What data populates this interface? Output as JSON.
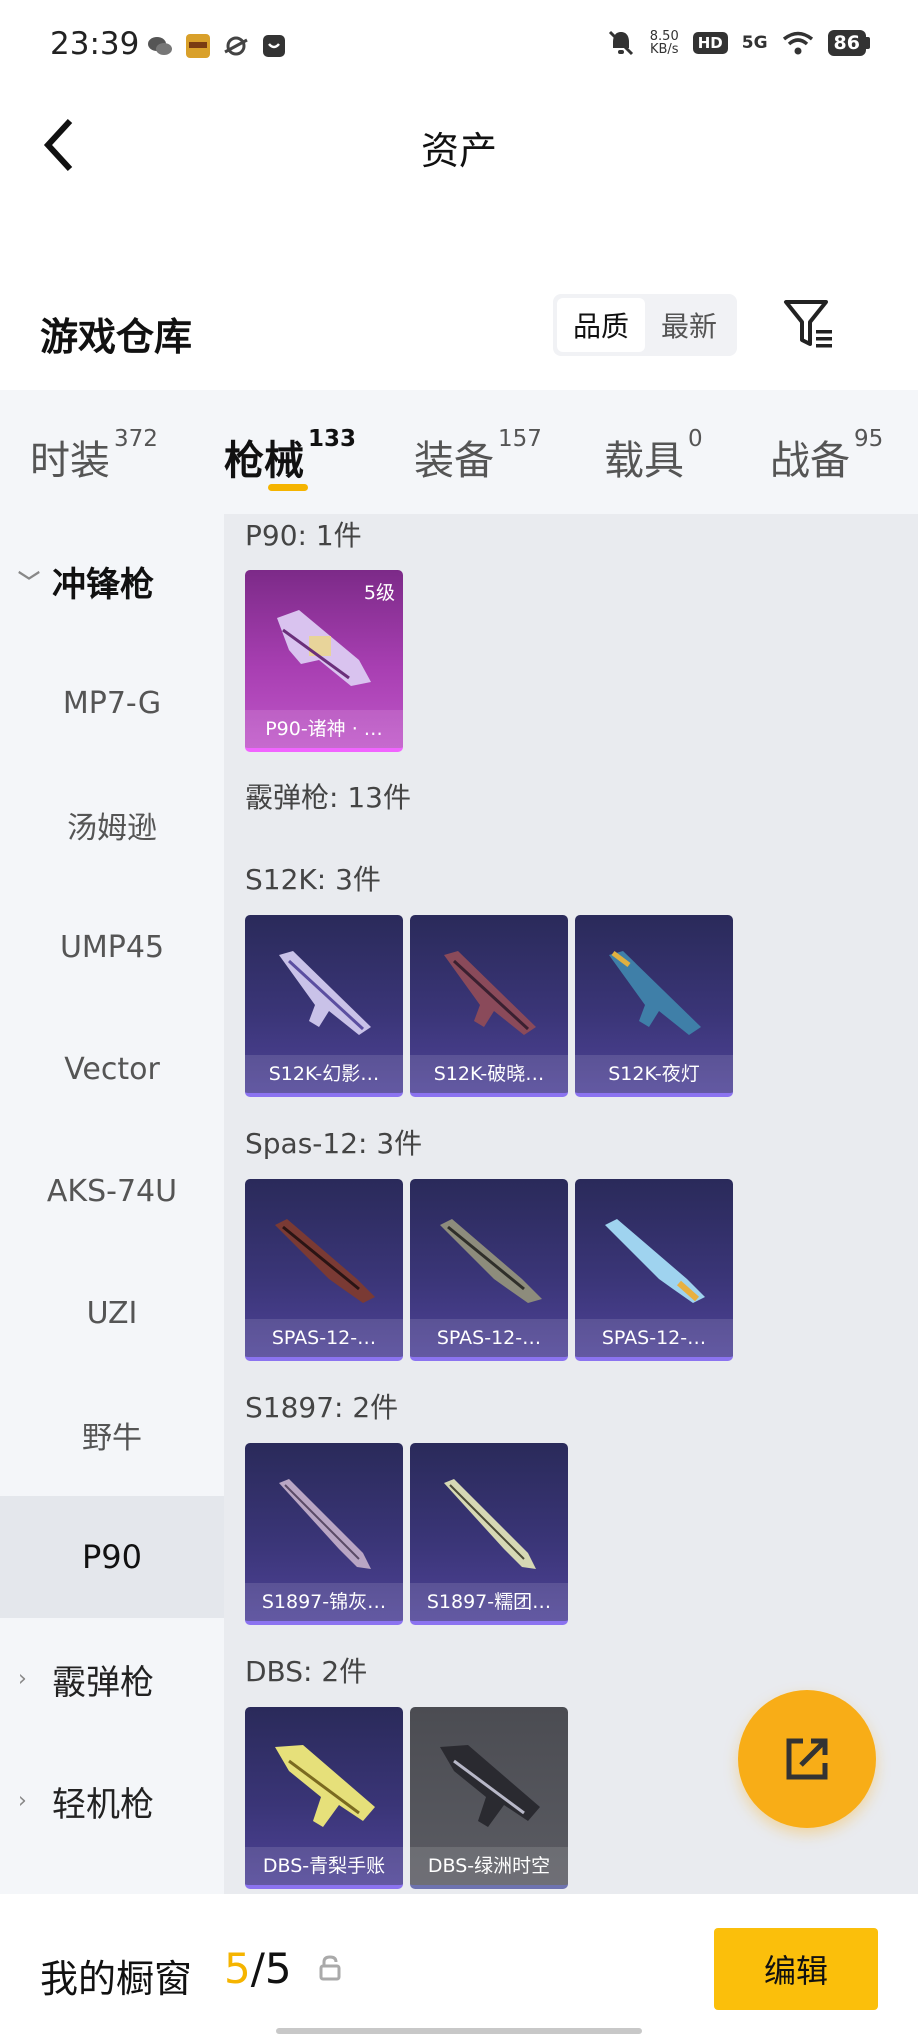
{
  "status_bar": {
    "time": "23:39",
    "net_speed": "8.50",
    "net_unit": "KB/s",
    "hd": "HD",
    "signal": "5G",
    "battery": "86"
  },
  "header": {
    "title": "资产"
  },
  "warehouse": {
    "title": "游戏仓库",
    "sort_quality": "品质",
    "sort_newest": "最新"
  },
  "tabs": [
    {
      "label": "时装",
      "count": "372"
    },
    {
      "label": "枪械",
      "count": "133"
    },
    {
      "label": "装备",
      "count": "157"
    },
    {
      "label": "载具",
      "count": "0"
    },
    {
      "label": "战备",
      "count": "95"
    }
  ],
  "sidebar": [
    {
      "label": "冲锋枪"
    },
    {
      "label": "MP7-G"
    },
    {
      "label": "汤姆逊"
    },
    {
      "label": "UMP45"
    },
    {
      "label": "Vector"
    },
    {
      "label": "AKS-74U"
    },
    {
      "label": "UZI"
    },
    {
      "label": "野牛"
    },
    {
      "label": "P90"
    },
    {
      "label": "霰弹枪"
    },
    {
      "label": "轻机枪"
    }
  ],
  "sections": {
    "p90": {
      "title": "P90: 1件",
      "items": [
        {
          "label": "P90-诸神 · …",
          "level": "5级"
        }
      ]
    },
    "shotgun": {
      "title": "霰弹枪: 13件"
    },
    "s12k": {
      "title": "S12K: 3件",
      "items": [
        {
          "label": "S12K-幻影…"
        },
        {
          "label": "S12K-破晓…"
        },
        {
          "label": "S12K-夜灯"
        }
      ]
    },
    "spas": {
      "title": "Spas-12: 3件",
      "items": [
        {
          "label": "SPAS-12-…"
        },
        {
          "label": "SPAS-12-…"
        },
        {
          "label": "SPAS-12-…"
        }
      ]
    },
    "s1897": {
      "title": "S1897: 2件",
      "items": [
        {
          "label": "S1897-锦灰…"
        },
        {
          "label": "S1897-糯团…"
        }
      ]
    },
    "dbs": {
      "title": "DBS: 2件",
      "items": [
        {
          "label": "DBS-青梨手账"
        },
        {
          "label": "DBS-绿洲时空"
        }
      ]
    }
  },
  "bottom_bar": {
    "title": "我的橱窗",
    "count_current": "5",
    "count_sep": "/5",
    "edit_label": "编辑"
  },
  "colors": {
    "accent": "#f5b400",
    "fab": "#f8ad17",
    "card_purple": "#3a3577",
    "card_pink": "#a83fb2"
  }
}
